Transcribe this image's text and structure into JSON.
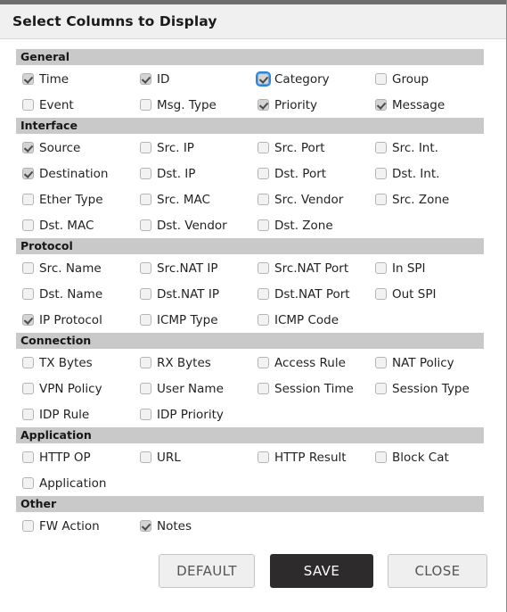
{
  "dialog": {
    "title": "Select Columns to Display"
  },
  "sections": [
    {
      "name": "General",
      "rows": [
        [
          {
            "label": "Time",
            "checked": true,
            "focused": false
          },
          {
            "label": "ID",
            "checked": true,
            "focused": false
          },
          {
            "label": "Category",
            "checked": true,
            "focused": true
          },
          {
            "label": "Group",
            "checked": false,
            "focused": false
          }
        ],
        [
          {
            "label": "Event",
            "checked": false,
            "focused": false
          },
          {
            "label": "Msg. Type",
            "checked": false,
            "focused": false
          },
          {
            "label": "Priority",
            "checked": true,
            "focused": false
          },
          {
            "label": "Message",
            "checked": true,
            "focused": false
          }
        ]
      ]
    },
    {
      "name": "Interface",
      "rows": [
        [
          {
            "label": "Source",
            "checked": true,
            "focused": false
          },
          {
            "label": "Src. IP",
            "checked": false,
            "focused": false
          },
          {
            "label": "Src. Port",
            "checked": false,
            "focused": false
          },
          {
            "label": "Src. Int.",
            "checked": false,
            "focused": false
          }
        ],
        [
          {
            "label": "Destination",
            "checked": true,
            "focused": false
          },
          {
            "label": "Dst. IP",
            "checked": false,
            "focused": false
          },
          {
            "label": "Dst. Port",
            "checked": false,
            "focused": false
          },
          {
            "label": "Dst. Int.",
            "checked": false,
            "focused": false
          }
        ],
        [
          {
            "label": "Ether Type",
            "checked": false,
            "focused": false
          },
          {
            "label": "Src. MAC",
            "checked": false,
            "focused": false
          },
          {
            "label": "Src. Vendor",
            "checked": false,
            "focused": false
          },
          {
            "label": "Src. Zone",
            "checked": false,
            "focused": false
          }
        ],
        [
          {
            "label": "Dst. MAC",
            "checked": false,
            "focused": false
          },
          {
            "label": "Dst. Vendor",
            "checked": false,
            "focused": false
          },
          {
            "label": "Dst. Zone",
            "checked": false,
            "focused": false
          },
          null
        ]
      ]
    },
    {
      "name": "Protocol",
      "rows": [
        [
          {
            "label": "Src. Name",
            "checked": false,
            "focused": false
          },
          {
            "label": "Src.NAT IP",
            "checked": false,
            "focused": false
          },
          {
            "label": "Src.NAT Port",
            "checked": false,
            "focused": false
          },
          {
            "label": "In SPI",
            "checked": false,
            "focused": false
          }
        ],
        [
          {
            "label": "Dst. Name",
            "checked": false,
            "focused": false
          },
          {
            "label": "Dst.NAT IP",
            "checked": false,
            "focused": false
          },
          {
            "label": "Dst.NAT Port",
            "checked": false,
            "focused": false
          },
          {
            "label": "Out SPI",
            "checked": false,
            "focused": false
          }
        ],
        [
          {
            "label": "IP Protocol",
            "checked": true,
            "focused": false
          },
          {
            "label": "ICMP Type",
            "checked": false,
            "focused": false
          },
          {
            "label": "ICMP Code",
            "checked": false,
            "focused": false
          },
          null
        ]
      ]
    },
    {
      "name": "Connection",
      "rows": [
        [
          {
            "label": "TX Bytes",
            "checked": false,
            "focused": false
          },
          {
            "label": "RX Bytes",
            "checked": false,
            "focused": false
          },
          {
            "label": "Access Rule",
            "checked": false,
            "focused": false
          },
          {
            "label": "NAT Policy",
            "checked": false,
            "focused": false
          }
        ],
        [
          {
            "label": "VPN Policy",
            "checked": false,
            "focused": false
          },
          {
            "label": "User Name",
            "checked": false,
            "focused": false
          },
          {
            "label": "Session Time",
            "checked": false,
            "focused": false
          },
          {
            "label": "Session Type",
            "checked": false,
            "focused": false
          }
        ],
        [
          {
            "label": "IDP Rule",
            "checked": false,
            "focused": false
          },
          {
            "label": "IDP Priority",
            "checked": false,
            "focused": false
          },
          null,
          null
        ]
      ]
    },
    {
      "name": "Application",
      "rows": [
        [
          {
            "label": "HTTP OP",
            "checked": false,
            "focused": false
          },
          {
            "label": "URL",
            "checked": false,
            "focused": false
          },
          {
            "label": "HTTP Result",
            "checked": false,
            "focused": false
          },
          {
            "label": "Block Cat",
            "checked": false,
            "focused": false
          }
        ],
        [
          {
            "label": "Application",
            "checked": false,
            "focused": false
          },
          null,
          null,
          null
        ]
      ]
    },
    {
      "name": "Other",
      "rows": [
        [
          {
            "label": "FW Action",
            "checked": false,
            "focused": false
          },
          {
            "label": "Notes",
            "checked": true,
            "focused": false
          },
          null,
          null
        ]
      ]
    }
  ],
  "footer": {
    "default_label": "DEFAULT",
    "save_label": "SAVE",
    "close_label": "CLOSE"
  },
  "colors": {
    "top_bar": "#6e6e6e",
    "titlebar_bg": "#f0f0f0",
    "section_header_bg": "#c9c9c9",
    "save_button_bg": "#2d2b2b",
    "focus_ring": "#2f86d6"
  }
}
